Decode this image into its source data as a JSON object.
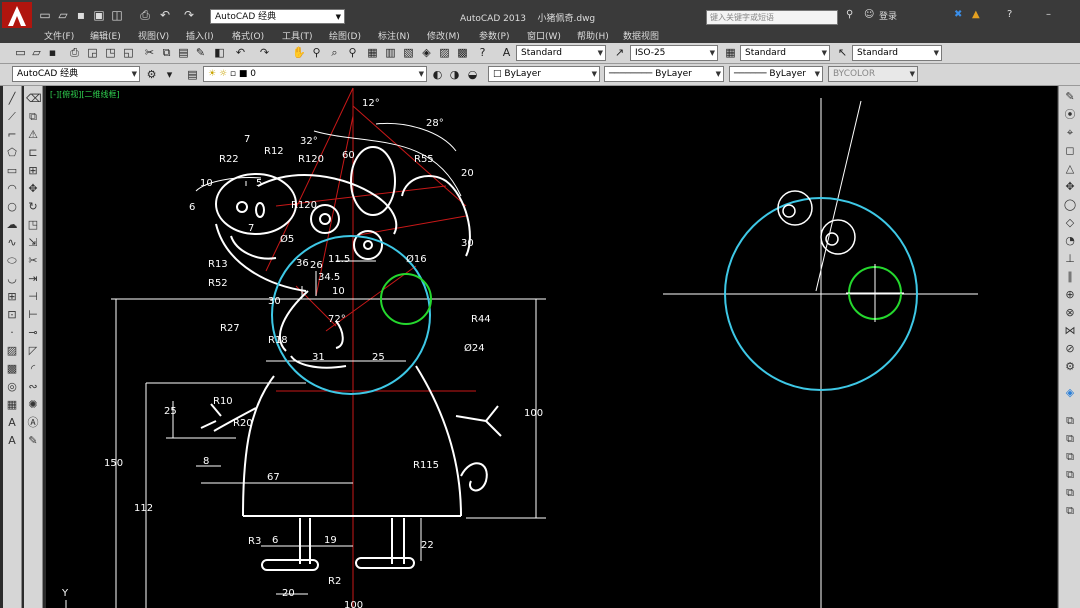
{
  "titlebar": {
    "app_title": "AutoCAD 2013",
    "file_name": "小猪佩奇.dwg",
    "workspace": "AutoCAD 经典",
    "search_placeholder": "键入关键字或短语",
    "login": "登录",
    "help": "?"
  },
  "menu": [
    "文件(F)",
    "编辑(E)",
    "视图(V)",
    "插入(I)",
    "格式(O)",
    "工具(T)",
    "绘图(D)",
    "标注(N)",
    "修改(M)",
    "参数(P)",
    "窗口(W)",
    "帮助(H)",
    "数据视图"
  ],
  "toolbar": {
    "text_style": "Standard",
    "dim_style": "ISO-25",
    "table_style": "Standard",
    "mleader_style": "Standard",
    "workspace2": "AutoCAD 经典",
    "layer": "0",
    "color": "ByLayer",
    "linetype": "ByLayer",
    "lineweight": "ByLayer",
    "plotstyle": "BYCOLOR"
  },
  "viewport_label": "[-][俯视][二维线框]",
  "ucs_label": "Y",
  "dimensions": {
    "angle12": "12°",
    "angle28": "28°",
    "angle32": "32°",
    "d60": "60",
    "r55": "R55",
    "d20": "20",
    "d30": "30",
    "r22": "R22",
    "d7": "7",
    "r12": "R12",
    "r120a": "R120",
    "r120b": "R120",
    "d10": "10",
    "d5": "5",
    "d6": "6",
    "d7b": "7",
    "phi5": "Ø5",
    "d36": "36",
    "d26": "26",
    "d11_5": "11.5",
    "d34_5": "34.5",
    "d10b": "10",
    "phi16": "Ø16",
    "r13": "R13",
    "r52": "R52",
    "d30b": "30",
    "r27": "R27",
    "angle72": "72°",
    "r18": "R18",
    "r44": "R44",
    "phi24": "Ø24",
    "d31": "31",
    "d25": "25",
    "r10": "R10",
    "d25b": "25",
    "r20": "R20",
    "d8": "8",
    "d150": "150",
    "d100": "100",
    "r115": "R115",
    "d67": "67",
    "d112": "112",
    "r3": "R3",
    "d6b": "6",
    "d19": "19",
    "d22": "22",
    "r2": "R2",
    "d20b": "20",
    "d100b": "100"
  },
  "colors": {
    "background": "#000000",
    "geometry": "#ffffff",
    "construction": "#c81818",
    "cyan_circle": "#3ec8e6",
    "green_circle": "#25d82e",
    "ui_panel": "#d6d6d6",
    "title_bar": "#3a3a3a"
  }
}
